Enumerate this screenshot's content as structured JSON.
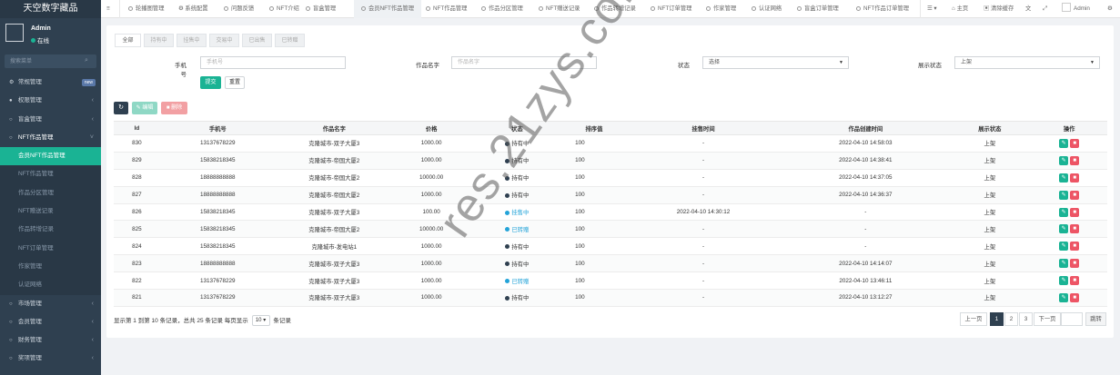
{
  "sidebar": {
    "brand": "天空数字藏品",
    "user": {
      "name": "Admin",
      "status": "在线"
    },
    "search_placeholder": "搜索菜单",
    "items": [
      {
        "label": "常规管理",
        "icon": "gears-icon",
        "badge": "new"
      },
      {
        "label": "权限管理",
        "icon": "users-icon"
      },
      {
        "label": "盲盒管理",
        "icon": "circle-icon"
      },
      {
        "label": "NFT作品管理",
        "icon": "circle-icon"
      },
      {
        "label": "会员NFT作品管理",
        "icon": "circle-icon"
      }
    ],
    "sub_items": [
      "NFT作品管理",
      "作品分区管理",
      "NFT赠送记录",
      "作品转增记录",
      "NFT订单管理",
      "作家管理",
      "认证网络"
    ],
    "bottom_items": [
      "市场管理",
      "会员管理",
      "财务管理",
      "奖项管理"
    ]
  },
  "topbar": {
    "tabs": [
      "轮播图管理",
      "系统配置",
      "问题反馈",
      "NFT介绍",
      "盲盒管理",
      "会员NFT作品管理",
      "NFT作品管理",
      "作品分区管理",
      "NFT赠送记录",
      "作品转增记录",
      "NFT订单管理",
      "作家管理",
      "认证网络",
      "盲盒订单管理",
      "NFT作品订单管理"
    ],
    "home": "主页",
    "clear_cache": "清除缓存",
    "admin": "Admin"
  },
  "filter_tabs": [
    "全部",
    "持有中",
    "挂售中",
    "交易中",
    "已出售",
    "已转赠"
  ],
  "filters": {
    "phone_label": "手机号",
    "phone_placeholder": "手机号",
    "name_label": "作品名字",
    "name_placeholder": "作品名字",
    "status_label": "状态",
    "status_value": "选择",
    "show_label": "展示状态",
    "show_value": "上架",
    "submit": "提交",
    "reset": "重置"
  },
  "toolbar": {
    "edit": "编辑",
    "delete": "删除"
  },
  "table": {
    "headers": [
      "Id",
      "手机号",
      "作品名字",
      "价格",
      "状态",
      "排序值",
      "挂售时间",
      "作品创建时间",
      "展示状态",
      "操作"
    ],
    "rows": [
      [
        "830",
        "13137678229",
        "克隆城市-双子大厦3",
        "1000.00",
        "持有中",
        "100",
        "-",
        "2022-04-10 14:58:03",
        "上架"
      ],
      [
        "829",
        "15838218345",
        "克隆城市-帝国大厦2",
        "1000.00",
        "持有中",
        "100",
        "-",
        "2022-04-10 14:38:41",
        "上架"
      ],
      [
        "828",
        "18888888888",
        "克隆城市-帝国大厦2",
        "10000.00",
        "持有中",
        "100",
        "-",
        "2022-04-10 14:37:05",
        "上架"
      ],
      [
        "827",
        "18888888888",
        "克隆城市-帝国大厦2",
        "1000.00",
        "持有中",
        "100",
        "-",
        "2022-04-10 14:36:37",
        "上架"
      ],
      [
        "826",
        "15838218345",
        "克隆城市-双子大厦3",
        "100.00",
        "挂售中",
        "100",
        "2022-04-10 14:30:12",
        "-",
        "上架"
      ],
      [
        "825",
        "15838218345",
        "克隆城市-帝国大厦2",
        "10000.00",
        "已转赠",
        "100",
        "-",
        "-",
        "上架"
      ],
      [
        "824",
        "15838218345",
        "克隆城市-发电站1",
        "1000.00",
        "持有中",
        "100",
        "-",
        "-",
        "上架"
      ],
      [
        "823",
        "18888888888",
        "克隆城市-双子大厦3",
        "1000.00",
        "持有中",
        "100",
        "-",
        "2022-04-10 14:14:07",
        "上架"
      ],
      [
        "822",
        "13137678229",
        "克隆城市-双子大厦3",
        "1000.00",
        "已转赠",
        "100",
        "-",
        "2022-04-10 13:46:11",
        "上架"
      ],
      [
        "821",
        "13137678229",
        "克隆城市-双子大厦3",
        "1000.00",
        "持有中",
        "100",
        "-",
        "2022-04-10 13:12:27",
        "上架"
      ]
    ]
  },
  "footer": {
    "info_prefix": "显示第 1 到第 10 条记录，总共 25 条记录 每页显示",
    "page_size": "10",
    "info_suffix": "条记录",
    "prev": "上一页",
    "pages": [
      "1",
      "2",
      "3"
    ],
    "next": "下一页",
    "go": "跳转"
  },
  "watermark": "res.21zys.com",
  "colors": {
    "sidebar": "#2f4050",
    "accent": "#1ab394",
    "danger": "#ed5565",
    "info": "#23a3d8"
  }
}
